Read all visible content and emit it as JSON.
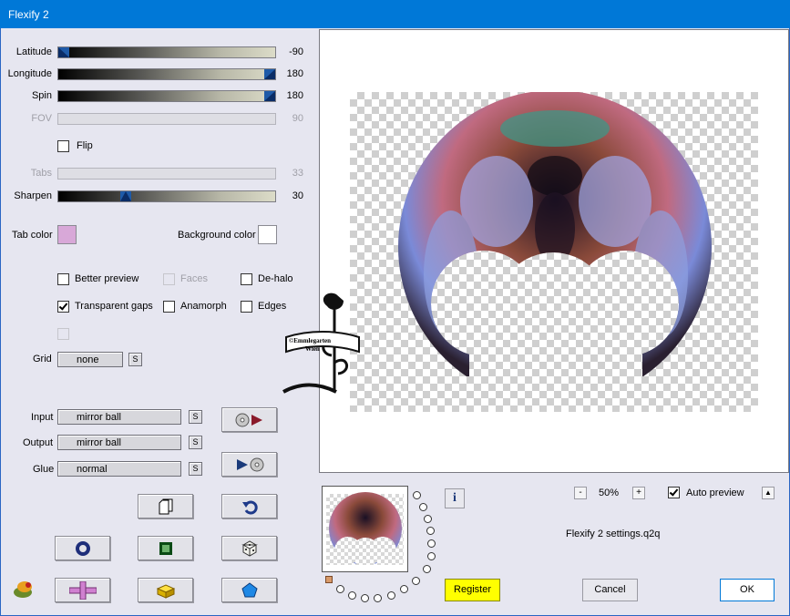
{
  "window": {
    "title": "Flexify 2"
  },
  "sliders": {
    "latitude": {
      "label": "Latitude",
      "value": "-90",
      "fraction": 0.0
    },
    "longitude": {
      "label": "Longitude",
      "value": "180",
      "fraction": 1.0
    },
    "spin": {
      "label": "Spin",
      "value": "180",
      "fraction": 1.0
    },
    "fov": {
      "label": "FOV",
      "value": "90",
      "fraction": 0.5
    },
    "tabs": {
      "label": "Tabs",
      "value": "33",
      "fraction": 0.33
    },
    "sharpen": {
      "label": "Sharpen",
      "value": "30",
      "fraction": 0.3
    }
  },
  "options": {
    "flip": "Flip",
    "better_preview": "Better preview",
    "faces": "Faces",
    "de_halo": "De-halo",
    "transparent_gaps": "Transparent gaps",
    "anamorph": "Anamorph",
    "edges": "Edges"
  },
  "colors": {
    "tab_color_label": "Tab color",
    "tab_color": "#d8a8d8",
    "background_color_label": "Background color",
    "background_color": "#ffffff"
  },
  "grid": {
    "label": "Grid",
    "value": "none",
    "s": "S"
  },
  "projection": {
    "input_label": "Input",
    "input_value": "mirror ball",
    "output_label": "Output",
    "output_value": "mirror ball",
    "glue_label": "Glue",
    "glue_value": "normal",
    "s": "S"
  },
  "watermark": {
    "line1": "©Emmlegarten",
    "line2": "Wien"
  },
  "zoom": {
    "minus": "-",
    "value": "50%",
    "plus": "+"
  },
  "auto_preview": {
    "label": "Auto preview",
    "arrow": "▲"
  },
  "info": "i",
  "settings_file": "Flexify 2 settings.q2q",
  "buttons": {
    "register": "Register",
    "cancel": "Cancel",
    "ok": "OK"
  }
}
